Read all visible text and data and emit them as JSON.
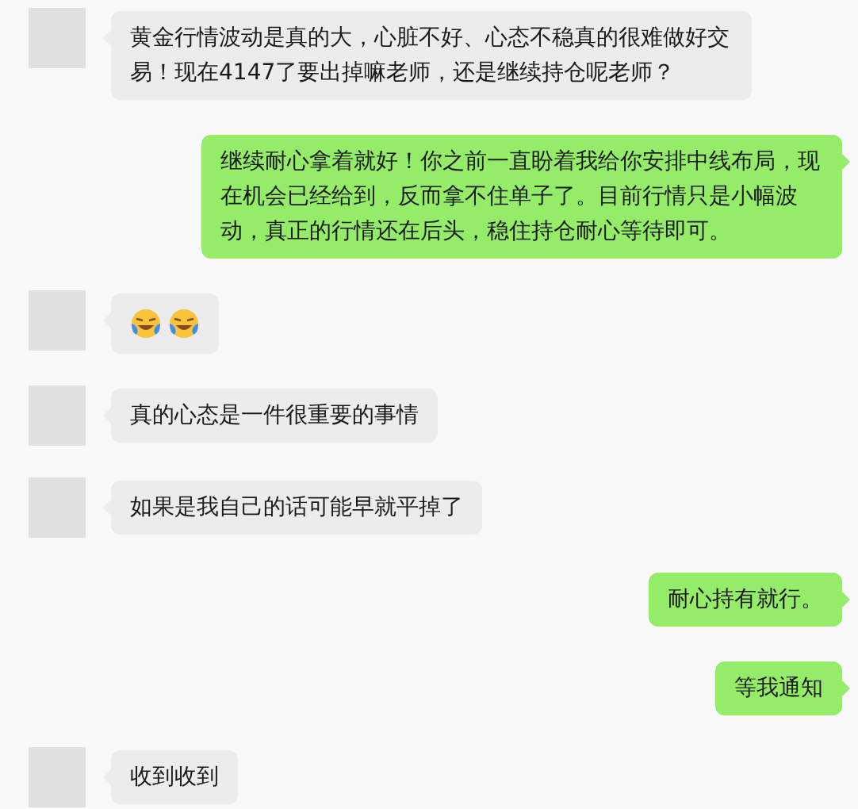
{
  "messages": [
    {
      "outgoing": false,
      "kind": "text",
      "text": "黄金行情波动是真的大，心脏不好、心态不稳真的很难做好交易！现在4147了要出掉嘛老师，还是继续持仓呢老师？"
    },
    {
      "outgoing": true,
      "kind": "text",
      "text": "继续耐心拿着就好！你之前一直盼着我给你安排中线布局，现在机会已经给到，反而拿不住单子了。目前行情只是小幅波动，真正的行情还在后头，稳住持仓耐心等待即可。"
    },
    {
      "outgoing": false,
      "kind": "emoji",
      "emojis": [
        {
          "kind": "laugh-cry"
        },
        {
          "kind": "laugh-cry"
        }
      ]
    },
    {
      "outgoing": false,
      "kind": "text",
      "text": "真的心态是一件很重要的事情"
    },
    {
      "outgoing": false,
      "kind": "text",
      "text": "如果是我自己的话可能早就平掉了"
    },
    {
      "outgoing": true,
      "kind": "text",
      "text": "耐心持有就行。"
    },
    {
      "outgoing": true,
      "kind": "text",
      "text": "等我通知"
    },
    {
      "outgoing": false,
      "kind": "text",
      "text": "收到收到"
    }
  ]
}
